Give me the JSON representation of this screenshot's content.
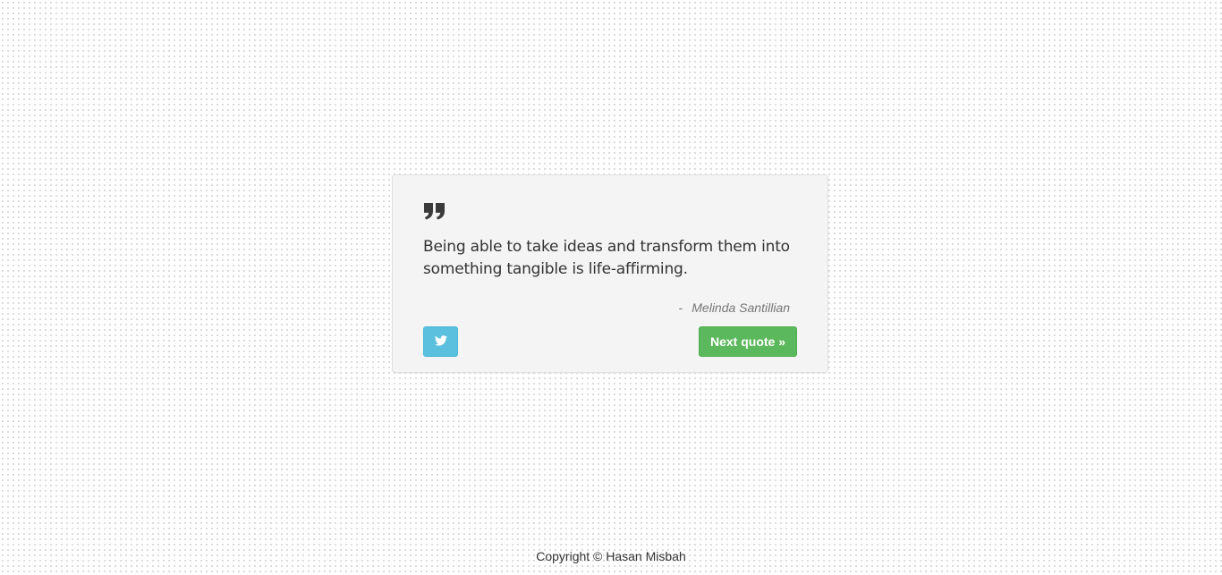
{
  "quote": {
    "icon": "quote-right-icon",
    "text": "Being able to take ideas and transform them into something tangible is life-affirming.",
    "author_prefix": "-",
    "author": "Melinda Santillian"
  },
  "actions": {
    "tweet_icon": "twitter-icon",
    "next_label": "Next quote »"
  },
  "footer": {
    "copyright": "Copyright © Hasan Misbah"
  },
  "colors": {
    "card_background": "#f4f4f4",
    "tweet_button": "#5bc0de",
    "next_button": "#5cb85c",
    "text": "#333333",
    "author_text": "#777777"
  }
}
